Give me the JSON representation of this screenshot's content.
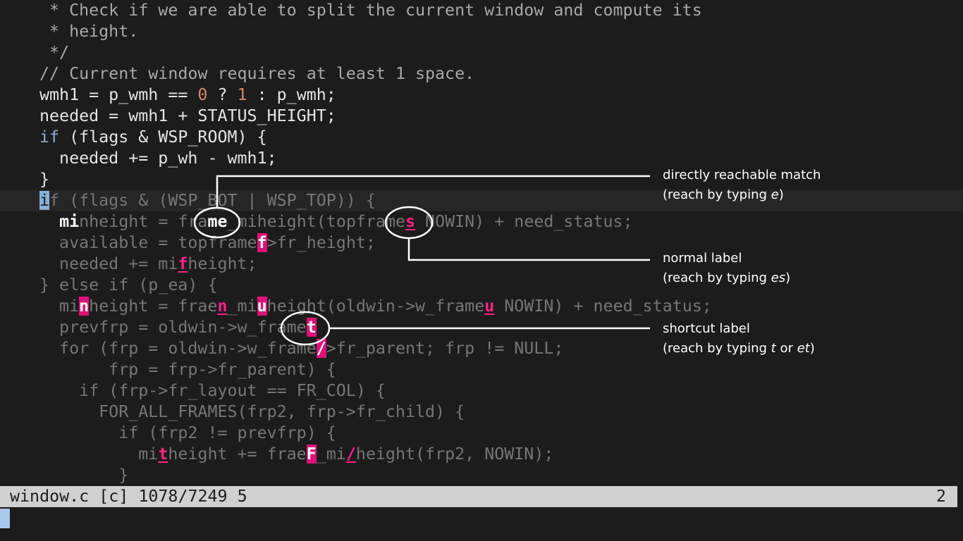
{
  "editor": {
    "lines": {
      "l1": " * Check if we are able to split the current window and compute its",
      "l2": " * height.",
      "l3": " */",
      "l4": "// Current window requires at least 1 space.",
      "l5a": "wmh1 = p_wmh == ",
      "l5b": "0",
      "l5c": " ? ",
      "l5d": "1",
      "l5e": " : p_wmh;",
      "l6": "needed = wmh1 + STATUS_HEIGHT;",
      "l7a": "if",
      "l7b": " (flags & WSP_ROOM) {",
      "l8": "  needed += p_wh - wmh1;",
      "l9": "}",
      "l10a": "i",
      "l10b": "f (flags & (WSP_BOT | WSP_TOP)) {",
      "l11a": "  ",
      "l11b": "mi",
      "l11c": "nheight = fra",
      "l11d": "me",
      "l11e": "_miheight(topframe",
      "l11f": "s",
      "l11g": "s",
      "l11h": " NOWIN) + need_status;",
      "l12a": "  available = topframe",
      "l12b": "f",
      "l12c": ">fr_height;",
      "l13a": "  needed += mi",
      "l13b": "f",
      "l13c": "height;",
      "l14": "} else if (p_ea) {",
      "l15a": "  mi",
      "l15b": "n",
      "l15c": "height = frae",
      "l15d": "n",
      "l15e": "_mi",
      "l15f": "u",
      "l15g": "height(oldwin->w_frame",
      "l15h": "u",
      "l15i": " NOWIN) + need_status;",
      "l16a": "  prevfrp = oldwin->w_frame",
      "l16b": "t",
      "l17a": "  for (frp = oldwin->w_frame",
      "l17b": "/",
      "l17c": ">fr_parent; frp != NULL;",
      "l18": "       frp = frp->fr_parent) {",
      "l19": "    if (frp->fr_layout == FR_COL) {",
      "l20": "      FOR_ALL_FRAMES(frp2, frp->fr_child) {",
      "l21": "        if (frp2 != prevfrp) {",
      "l22a": "          mi",
      "l22b": "t",
      "l22c": "height += frae",
      "l22d": "F",
      "l22e": "_mi",
      "l22f": "/",
      "l22g": "height(frp2, NOWIN);",
      "l23": "        }"
    }
  },
  "status": {
    "left": "window.c [c] 1078/7249 5",
    "right": "2"
  },
  "annotations": {
    "direct": {
      "title": "directly reachable match",
      "pre": "(reach by typing ",
      "key": "e",
      "post": ")"
    },
    "normal": {
      "title": "normal label",
      "pre": "(reach by typing ",
      "key": "es",
      "post": ")"
    },
    "shortcut": {
      "title": "shortcut label",
      "pre": "(reach by typing ",
      "key1": "t",
      "mid": " or ",
      "key2": "et",
      "post": ")"
    }
  },
  "colors": {
    "background": "#1c1c1c",
    "label": "#e0107a",
    "statusline": "#d0d0d0",
    "keyword": "#87afd7",
    "number": "#d7875f"
  }
}
